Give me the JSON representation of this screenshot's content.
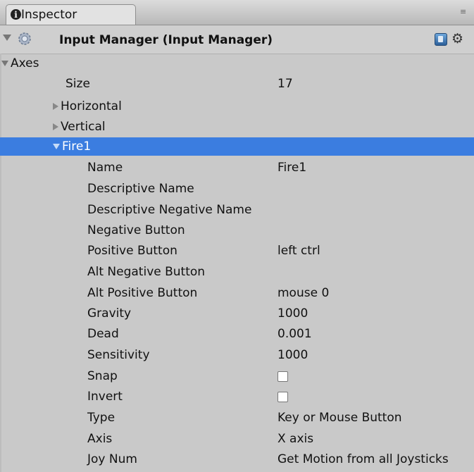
{
  "tab": {
    "title": "Inspector",
    "menu_glyph": "≡"
  },
  "header": {
    "title": "Input Manager (Input Manager)"
  },
  "axes": {
    "label": "Axes",
    "size_label": "Size",
    "size_value": "17"
  },
  "axis_items": [
    "Horizontal",
    "Vertical"
  ],
  "selected_axis": "Fire1",
  "properties": [
    {
      "label": "Name",
      "value": "Fire1"
    },
    {
      "label": "Descriptive Name",
      "value": ""
    },
    {
      "label": "Descriptive Negative Name",
      "value": ""
    },
    {
      "label": "Negative Button",
      "value": ""
    },
    {
      "label": "Positive Button",
      "value": "left ctrl"
    },
    {
      "label": "Alt Negative Button",
      "value": ""
    },
    {
      "label": "Alt Positive Button",
      "value": "mouse 0"
    },
    {
      "label": "Gravity",
      "value": "1000"
    },
    {
      "label": "Dead",
      "value": "0.001"
    },
    {
      "label": "Sensitivity",
      "value": "1000"
    },
    {
      "label": "Snap",
      "checked": false
    },
    {
      "label": "Invert",
      "checked": false
    },
    {
      "label": "Type",
      "value": "Key or Mouse Button"
    },
    {
      "label": "Axis",
      "value": "X axis"
    },
    {
      "label": "Joy Num",
      "value": "Get Motion from all Joysticks"
    }
  ],
  "colors": {
    "selection": "#3b7de0",
    "panel": "#c9c9c9"
  }
}
